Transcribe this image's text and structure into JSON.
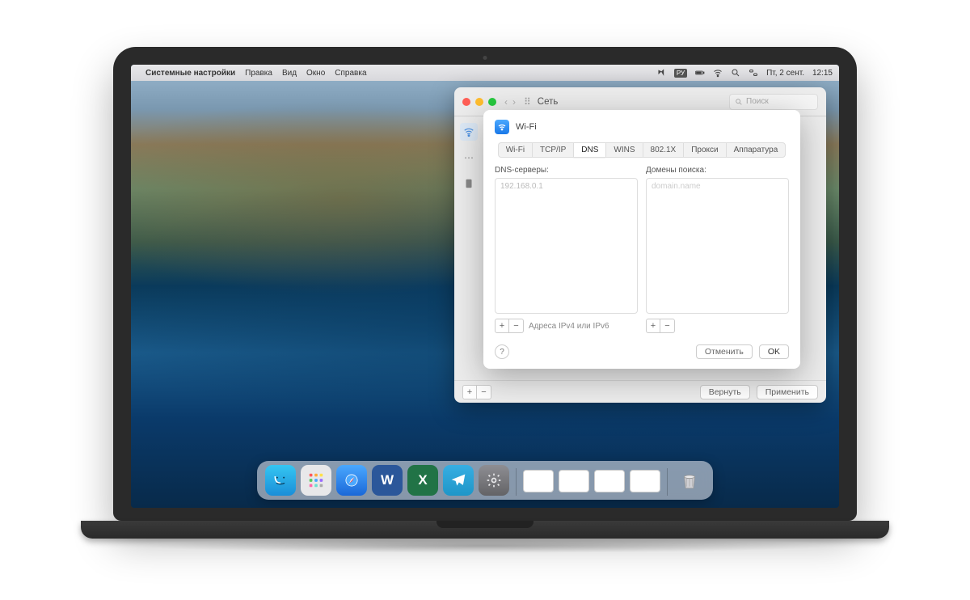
{
  "menubar": {
    "app_name": "Системные настройки",
    "items": [
      "Правка",
      "Вид",
      "Окно",
      "Справка"
    ],
    "input_lang": "РУ",
    "date": "Пт, 2 сент.",
    "time": "12:15"
  },
  "parent_window": {
    "title": "Сеть",
    "search_placeholder": "Поиск",
    "footer": {
      "revert_label": "Вернуть",
      "apply_label": "Применить"
    }
  },
  "sheet": {
    "title": "Wi-Fi",
    "tabs": [
      "Wi-Fi",
      "TCP/IP",
      "DNS",
      "WINS",
      "802.1X",
      "Прокси",
      "Аппаратура"
    ],
    "active_tab": "DNS",
    "dns": {
      "label": "DNS-серверы:",
      "entries": [
        "192.168.0.1"
      ],
      "foot_note": "Адреса IPv4 или IPv6"
    },
    "domains": {
      "label": "Домены поиска:",
      "placeholder": "domain.name"
    },
    "cancel_label": "Отменить",
    "ok_label": "OK"
  },
  "dock": {
    "apps": [
      "finder",
      "launchpad",
      "safari",
      "word",
      "excel",
      "telegram",
      "settings"
    ]
  }
}
